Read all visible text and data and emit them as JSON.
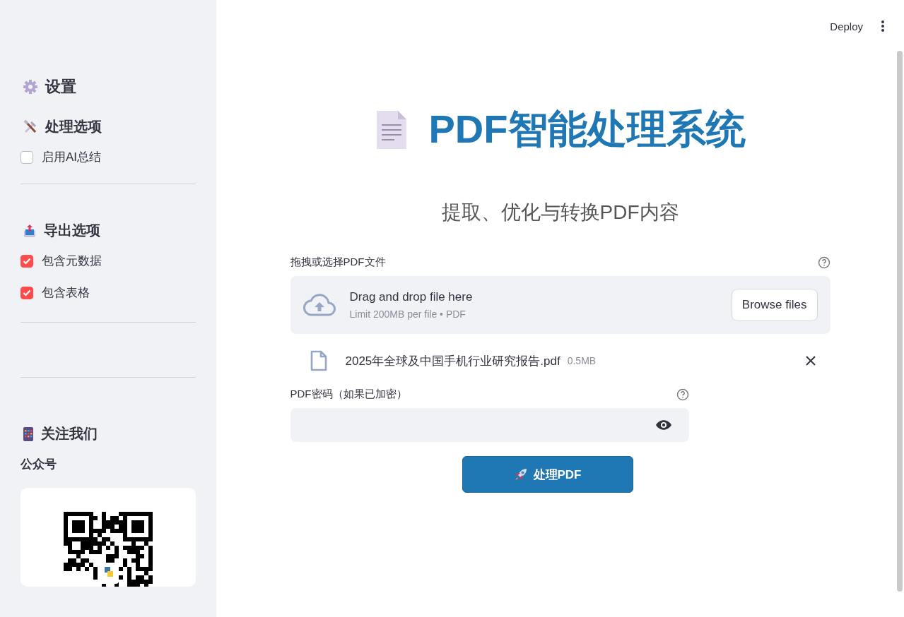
{
  "header": {
    "deploy": "Deploy"
  },
  "sidebar": {
    "title": "设置",
    "sections": [
      {
        "kind": "tools",
        "heading": "处理选项",
        "options": [
          {
            "label": "启用AI总结",
            "checked": false
          }
        ]
      },
      {
        "kind": "export",
        "heading": "导出选项",
        "options": [
          {
            "label": "包含元数据",
            "checked": true
          },
          {
            "label": "包含表格",
            "checked": true
          }
        ]
      },
      {
        "kind": "follow",
        "heading": "关注我们",
        "subheading": "公众号"
      }
    ]
  },
  "main": {
    "title": "PDF智能处理系统",
    "subtitle": "提取、优化与转换PDF内容",
    "uploader": {
      "label": "拖拽或选择PDF文件",
      "drop_text": "Drag and drop file here",
      "limit": "Limit 200MB per file • PDF",
      "button": "Browse files"
    },
    "file": {
      "name": "2025年全球及中国手机行业研究报告.pdf",
      "size": "0.5MB"
    },
    "password": {
      "label": "PDF密码（如果已加密）"
    },
    "process_button": "处理PDF"
  }
}
